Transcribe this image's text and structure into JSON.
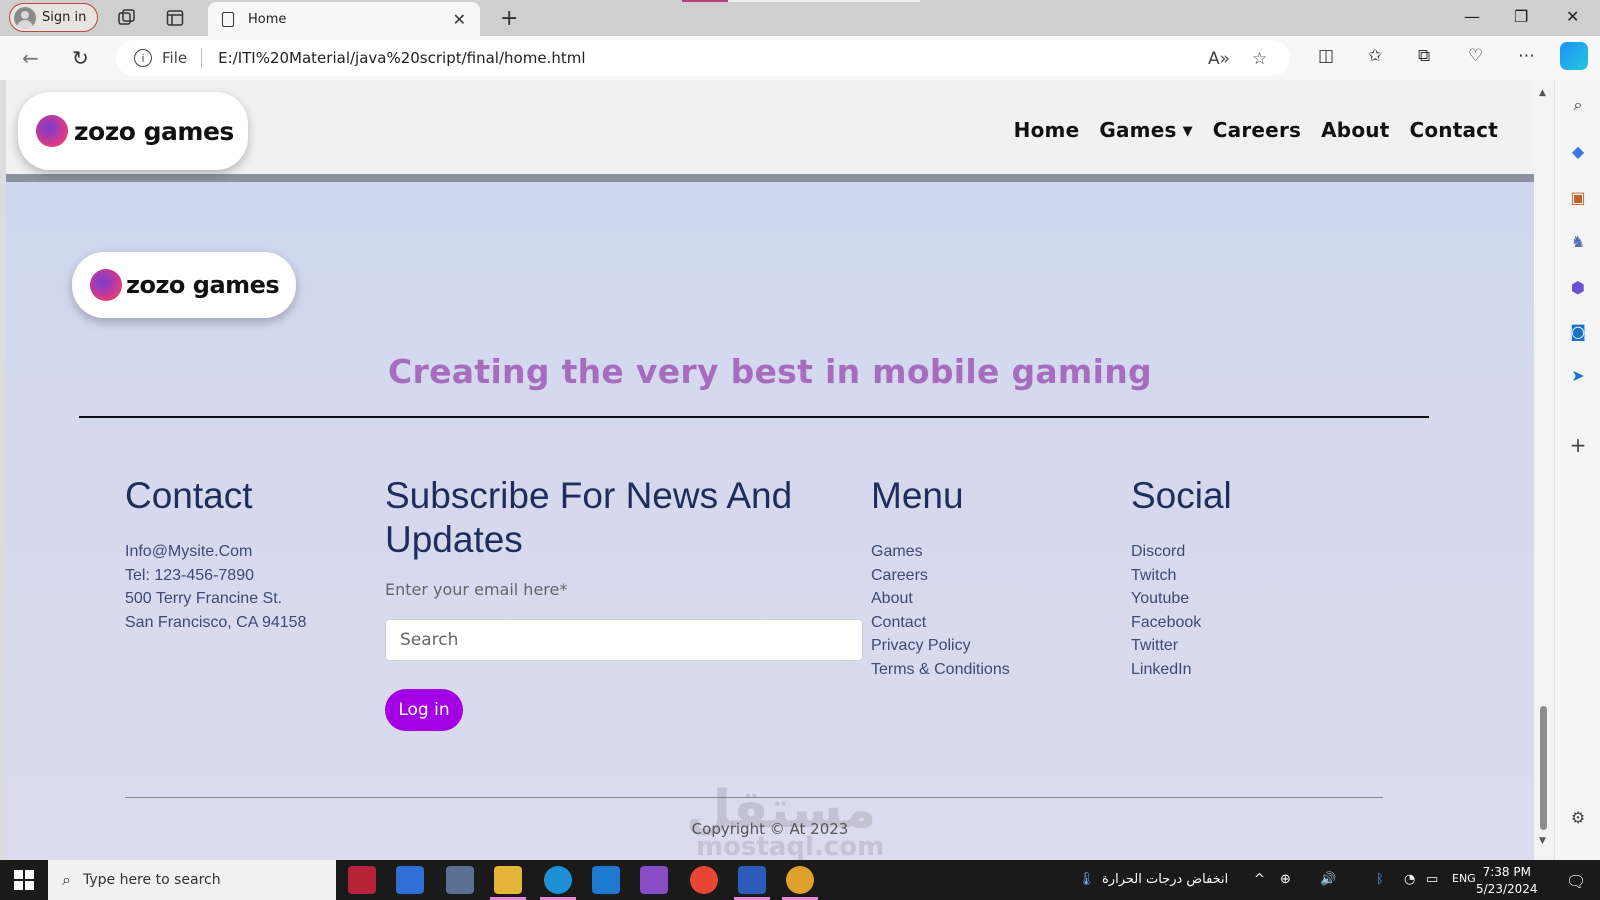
{
  "browser": {
    "signin_label": "Sign in",
    "tab_title": "Home",
    "address_prefix": "File",
    "url": "E:/ITI%20Material/java%20script/final/home.html"
  },
  "site": {
    "logo_text": "zozo games",
    "nav": {
      "home": "Home",
      "games": "Games",
      "careers": "Careers",
      "about": "About",
      "contact": "Contact"
    },
    "tagline": "Creating the very best in mobile gaming",
    "footer": {
      "contact": {
        "title": "Contact",
        "lines": [
          "Info@Mysite.Com",
          "Tel: 123-456-7890",
          "500 Terry Francine St.",
          "San Francisco, CA 94158"
        ]
      },
      "subscribe": {
        "title": "Subscribe For News And Updates",
        "email_label": "Enter your email here*",
        "input_placeholder": "Search",
        "button_label": "Log in"
      },
      "menu": {
        "title": "Menu",
        "items": [
          "Games",
          "Careers",
          "About",
          "Contact",
          "Privacy Policy",
          "Terms & Conditions"
        ]
      },
      "social": {
        "title": "Social",
        "items": [
          "Discord",
          "Twitch",
          "Youtube",
          "Facebook",
          "Twitter",
          "LinkedIn"
        ]
      },
      "copyright": "Copyright © At 2023"
    },
    "watermark": "مستقل",
    "watermark_sub": "mostaql.com"
  },
  "taskbar": {
    "search_placeholder": "Type here to search",
    "weather_text": "انخفاض درجات الحرارة",
    "language": "ENG",
    "time": "7:38 PM",
    "date": "5/23/2024"
  },
  "colors": {
    "accent_button": "#a400e6",
    "tagline": "#a86cbf",
    "heading": "#1f2d5a"
  }
}
